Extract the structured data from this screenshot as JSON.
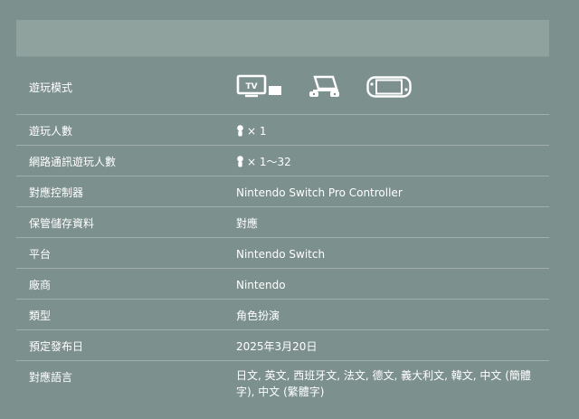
{
  "header": {
    "left_text": "",
    "right_text": ""
  },
  "specs": {
    "play_modes": {
      "label": "遊玩模式",
      "icons": [
        "tv-mode-icon",
        "tabletop-mode-icon",
        "handheld-mode-icon"
      ],
      "tv_text": "TV"
    },
    "players": {
      "label": "遊玩人數",
      "value": "× 1"
    },
    "online_players": {
      "label": "網路通訊遊玩人數",
      "value": "× 1～32"
    },
    "controller": {
      "label": "對應控制器",
      "value": "Nintendo Switch Pro Controller"
    },
    "save_data": {
      "label": "保管儲存資料",
      "value": "對應"
    },
    "platform": {
      "label": "平台",
      "value": "Nintendo Switch"
    },
    "publisher": {
      "label": "廠商",
      "value": "Nintendo"
    },
    "genre": {
      "label": "類型",
      "value": "角色扮演"
    },
    "release_date": {
      "label": "預定發布日",
      "value": "2025年3月20日"
    },
    "languages": {
      "label": "對應語言",
      "value": "日文, 英文, 西班牙文, 法文, 德文, 義大利文, 韓文, 中文 (簡體字), 中文 (繁體字)"
    }
  },
  "colors": {
    "background": "#7c908d",
    "header_bar": "#8fa29e",
    "text": "#ffffff"
  }
}
